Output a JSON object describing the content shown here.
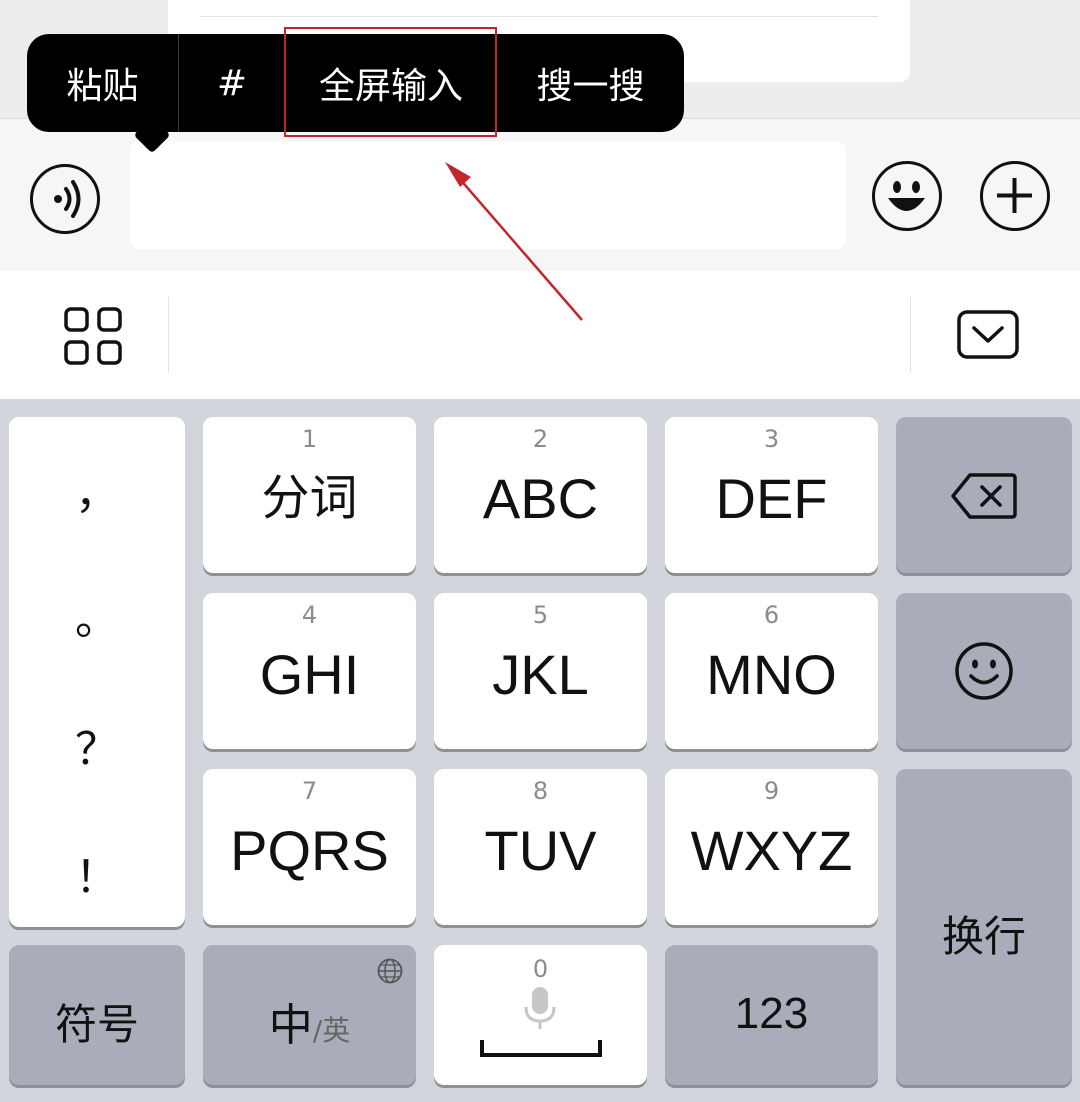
{
  "context_menu": {
    "items": [
      {
        "label": "粘贴"
      },
      {
        "label": "#"
      },
      {
        "label": "全屏输入"
      },
      {
        "label": "搜一搜"
      }
    ],
    "highlighted_index": 2,
    "highlight_color": "#c0272d"
  },
  "input_bar": {
    "voice_icon": "voice-icon",
    "emoji_icon": "emoji-icon",
    "add_icon": "plus-icon",
    "text_value": ""
  },
  "keyboard_toolbar": {
    "left_icon": "grid-icon",
    "right_icon": "dismiss-keyboard-icon"
  },
  "keyboard": {
    "punctuation": [
      "，",
      "。",
      "？",
      "！"
    ],
    "keys": [
      {
        "num": "1",
        "label": "分词"
      },
      {
        "num": "2",
        "label": "ABC"
      },
      {
        "num": "3",
        "label": "DEF"
      },
      {
        "num": "4",
        "label": "GHI"
      },
      {
        "num": "5",
        "label": "JKL"
      },
      {
        "num": "6",
        "label": "MNO"
      },
      {
        "num": "7",
        "label": "PQRS"
      },
      {
        "num": "8",
        "label": "TUV"
      },
      {
        "num": "9",
        "label": "WXYZ"
      }
    ],
    "symbols_label": "符号",
    "lang_primary": "中",
    "lang_secondary": "/英",
    "space_num": "0",
    "numeric_label": "123",
    "return_label": "换行",
    "delete_icon": "backspace-icon",
    "emoji_key_icon": "smiley-icon",
    "globe_icon": "globe-icon",
    "mic_icon": "microphone-icon"
  }
}
